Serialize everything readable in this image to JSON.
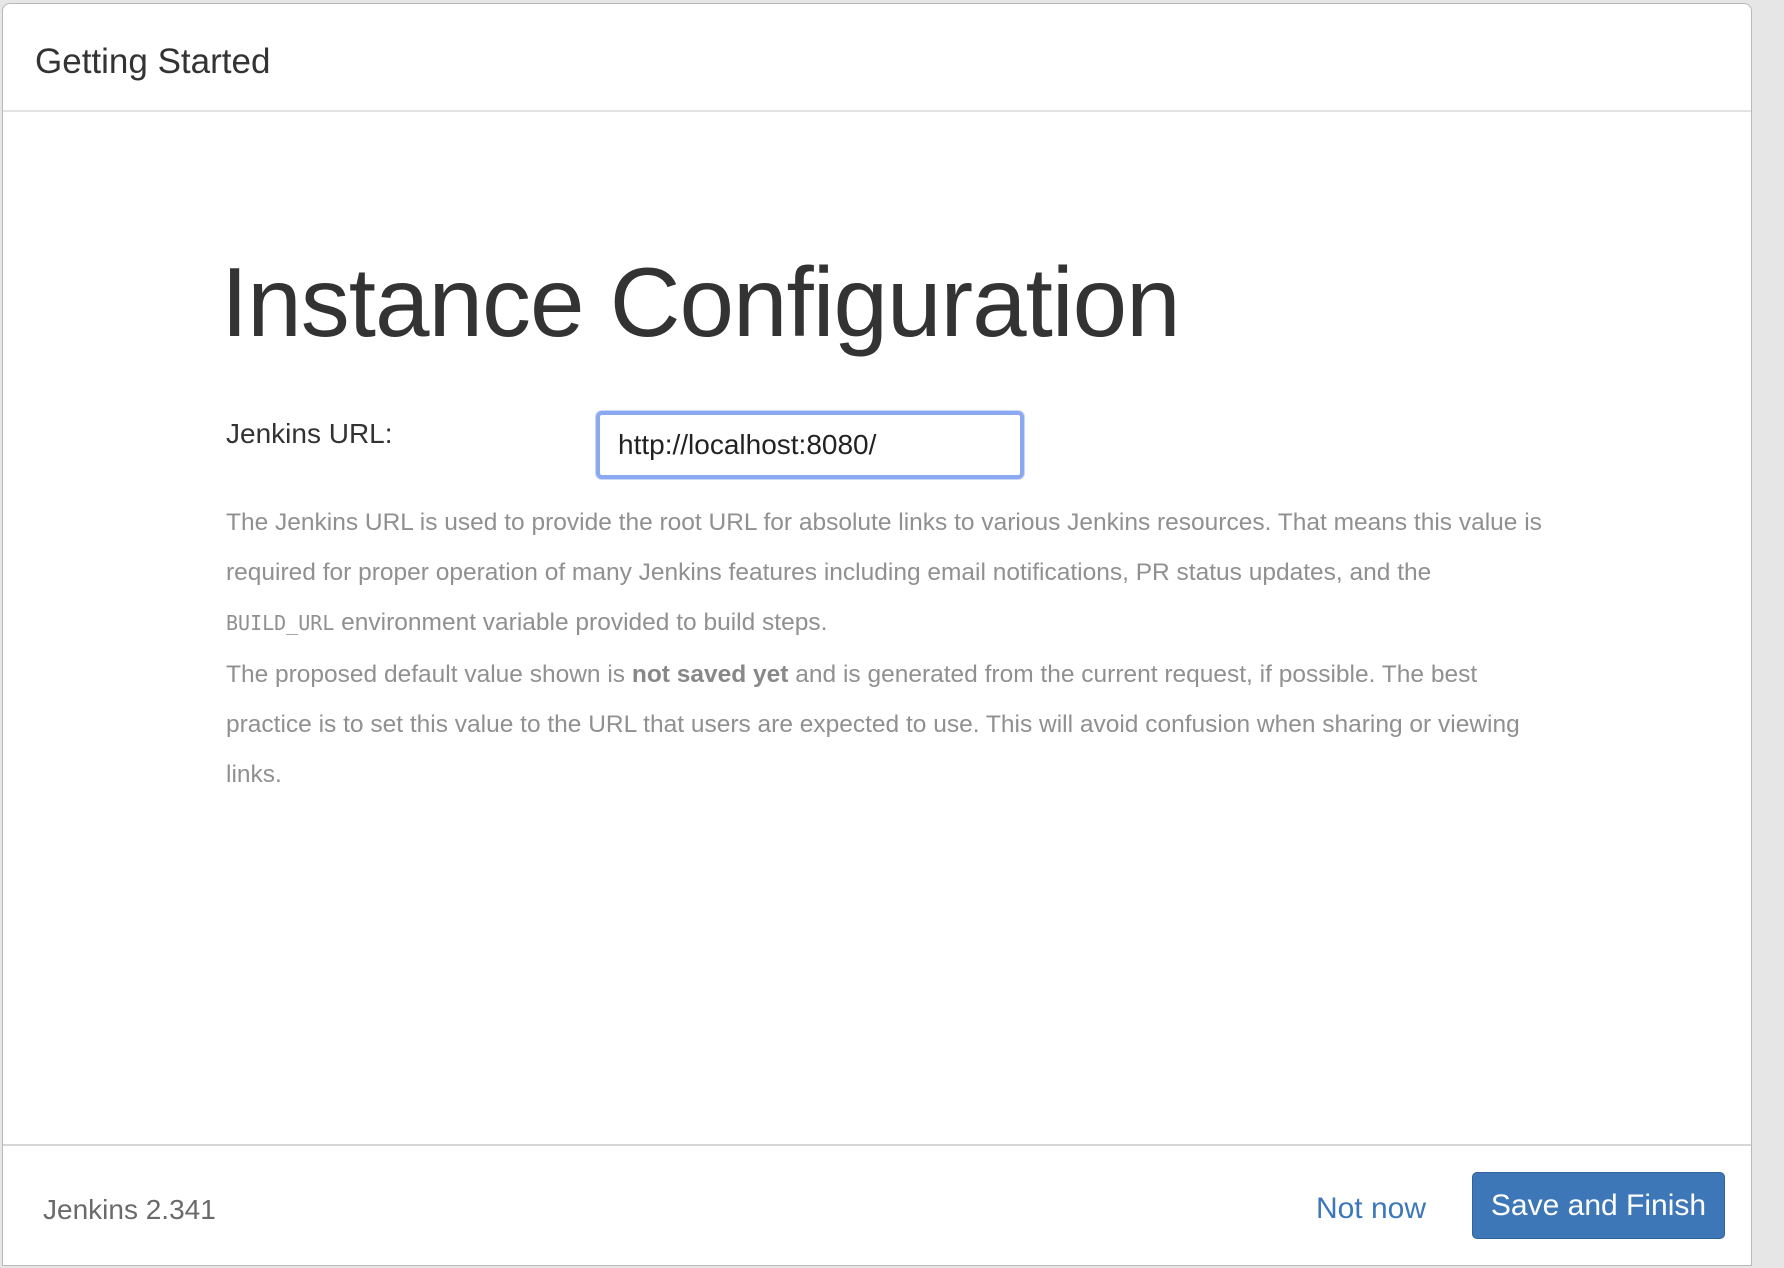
{
  "header": {
    "title": "Getting Started"
  },
  "main": {
    "page_title": "Instance Configuration",
    "url_label": "Jenkins URL:",
    "url_value": "http://localhost:8080/",
    "help_1_part_a": "The Jenkins URL is used to provide the root URL for absolute links to various Jenkins resources. That means this value is required for proper operation of many Jenkins features including email notifications, PR status updates, and the ",
    "help_1_code": "BUILD_URL",
    "help_1_part_b": " environment variable provided to build steps.",
    "help_2_part_a": "The proposed default value shown is ",
    "help_2_bold": "not saved yet",
    "help_2_part_b": " and is generated from the current request, if possible. The best practice is to set this value to the URL that users are expected to use. This will avoid confusion when sharing or viewing links."
  },
  "footer": {
    "version": "Jenkins 2.341",
    "not_now_label": "Not now",
    "save_label": "Save and Finish"
  },
  "colors": {
    "primary_button": "#3d77b7",
    "link": "#3c77b9",
    "input_focus_border": "#8aa9f0",
    "help_text": "#909090"
  }
}
